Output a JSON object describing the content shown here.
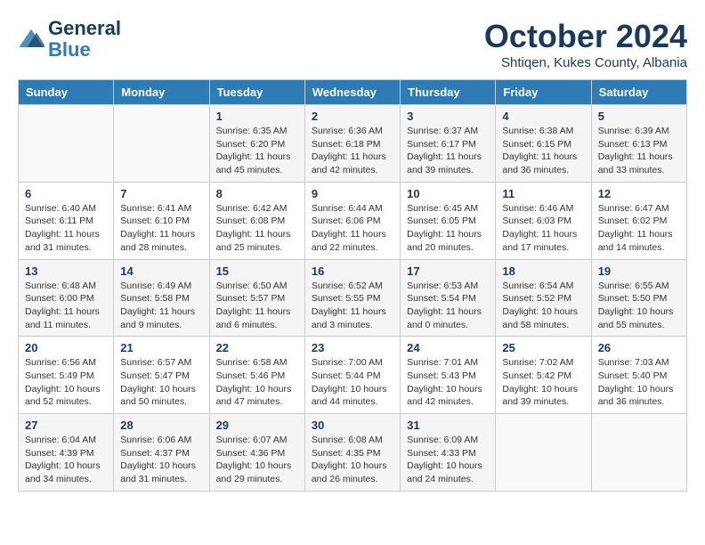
{
  "header": {
    "logo_line1": "General",
    "logo_line2": "Blue",
    "month_title": "October 2024",
    "location": "Shtiqen, Kukes County, Albania"
  },
  "days_of_week": [
    "Sunday",
    "Monday",
    "Tuesday",
    "Wednesday",
    "Thursday",
    "Friday",
    "Saturday"
  ],
  "weeks": [
    [
      {
        "day": "",
        "sunrise": "",
        "sunset": "",
        "daylight": ""
      },
      {
        "day": "",
        "sunrise": "",
        "sunset": "",
        "daylight": ""
      },
      {
        "day": "1",
        "sunrise": "Sunrise: 6:35 AM",
        "sunset": "Sunset: 6:20 PM",
        "daylight": "Daylight: 11 hours and 45 minutes."
      },
      {
        "day": "2",
        "sunrise": "Sunrise: 6:36 AM",
        "sunset": "Sunset: 6:18 PM",
        "daylight": "Daylight: 11 hours and 42 minutes."
      },
      {
        "day": "3",
        "sunrise": "Sunrise: 6:37 AM",
        "sunset": "Sunset: 6:17 PM",
        "daylight": "Daylight: 11 hours and 39 minutes."
      },
      {
        "day": "4",
        "sunrise": "Sunrise: 6:38 AM",
        "sunset": "Sunset: 6:15 PM",
        "daylight": "Daylight: 11 hours and 36 minutes."
      },
      {
        "day": "5",
        "sunrise": "Sunrise: 6:39 AM",
        "sunset": "Sunset: 6:13 PM",
        "daylight": "Daylight: 11 hours and 33 minutes."
      }
    ],
    [
      {
        "day": "6",
        "sunrise": "Sunrise: 6:40 AM",
        "sunset": "Sunset: 6:11 PM",
        "daylight": "Daylight: 11 hours and 31 minutes."
      },
      {
        "day": "7",
        "sunrise": "Sunrise: 6:41 AM",
        "sunset": "Sunset: 6:10 PM",
        "daylight": "Daylight: 11 hours and 28 minutes."
      },
      {
        "day": "8",
        "sunrise": "Sunrise: 6:42 AM",
        "sunset": "Sunset: 6:08 PM",
        "daylight": "Daylight: 11 hours and 25 minutes."
      },
      {
        "day": "9",
        "sunrise": "Sunrise: 6:44 AM",
        "sunset": "Sunset: 6:06 PM",
        "daylight": "Daylight: 11 hours and 22 minutes."
      },
      {
        "day": "10",
        "sunrise": "Sunrise: 6:45 AM",
        "sunset": "Sunset: 6:05 PM",
        "daylight": "Daylight: 11 hours and 20 minutes."
      },
      {
        "day": "11",
        "sunrise": "Sunrise: 6:46 AM",
        "sunset": "Sunset: 6:03 PM",
        "daylight": "Daylight: 11 hours and 17 minutes."
      },
      {
        "day": "12",
        "sunrise": "Sunrise: 6:47 AM",
        "sunset": "Sunset: 6:02 PM",
        "daylight": "Daylight: 11 hours and 14 minutes."
      }
    ],
    [
      {
        "day": "13",
        "sunrise": "Sunrise: 6:48 AM",
        "sunset": "Sunset: 6:00 PM",
        "daylight": "Daylight: 11 hours and 11 minutes."
      },
      {
        "day": "14",
        "sunrise": "Sunrise: 6:49 AM",
        "sunset": "Sunset: 5:58 PM",
        "daylight": "Daylight: 11 hours and 9 minutes."
      },
      {
        "day": "15",
        "sunrise": "Sunrise: 6:50 AM",
        "sunset": "Sunset: 5:57 PM",
        "daylight": "Daylight: 11 hours and 6 minutes."
      },
      {
        "day": "16",
        "sunrise": "Sunrise: 6:52 AM",
        "sunset": "Sunset: 5:55 PM",
        "daylight": "Daylight: 11 hours and 3 minutes."
      },
      {
        "day": "17",
        "sunrise": "Sunrise: 6:53 AM",
        "sunset": "Sunset: 5:54 PM",
        "daylight": "Daylight: 11 hours and 0 minutes."
      },
      {
        "day": "18",
        "sunrise": "Sunrise: 6:54 AM",
        "sunset": "Sunset: 5:52 PM",
        "daylight": "Daylight: 10 hours and 58 minutes."
      },
      {
        "day": "19",
        "sunrise": "Sunrise: 6:55 AM",
        "sunset": "Sunset: 5:50 PM",
        "daylight": "Daylight: 10 hours and 55 minutes."
      }
    ],
    [
      {
        "day": "20",
        "sunrise": "Sunrise: 6:56 AM",
        "sunset": "Sunset: 5:49 PM",
        "daylight": "Daylight: 10 hours and 52 minutes."
      },
      {
        "day": "21",
        "sunrise": "Sunrise: 6:57 AM",
        "sunset": "Sunset: 5:47 PM",
        "daylight": "Daylight: 10 hours and 50 minutes."
      },
      {
        "day": "22",
        "sunrise": "Sunrise: 6:58 AM",
        "sunset": "Sunset: 5:46 PM",
        "daylight": "Daylight: 10 hours and 47 minutes."
      },
      {
        "day": "23",
        "sunrise": "Sunrise: 7:00 AM",
        "sunset": "Sunset: 5:44 PM",
        "daylight": "Daylight: 10 hours and 44 minutes."
      },
      {
        "day": "24",
        "sunrise": "Sunrise: 7:01 AM",
        "sunset": "Sunset: 5:43 PM",
        "daylight": "Daylight: 10 hours and 42 minutes."
      },
      {
        "day": "25",
        "sunrise": "Sunrise: 7:02 AM",
        "sunset": "Sunset: 5:42 PM",
        "daylight": "Daylight: 10 hours and 39 minutes."
      },
      {
        "day": "26",
        "sunrise": "Sunrise: 7:03 AM",
        "sunset": "Sunset: 5:40 PM",
        "daylight": "Daylight: 10 hours and 36 minutes."
      }
    ],
    [
      {
        "day": "27",
        "sunrise": "Sunrise: 6:04 AM",
        "sunset": "Sunset: 4:39 PM",
        "daylight": "Daylight: 10 hours and 34 minutes."
      },
      {
        "day": "28",
        "sunrise": "Sunrise: 6:06 AM",
        "sunset": "Sunset: 4:37 PM",
        "daylight": "Daylight: 10 hours and 31 minutes."
      },
      {
        "day": "29",
        "sunrise": "Sunrise: 6:07 AM",
        "sunset": "Sunset: 4:36 PM",
        "daylight": "Daylight: 10 hours and 29 minutes."
      },
      {
        "day": "30",
        "sunrise": "Sunrise: 6:08 AM",
        "sunset": "Sunset: 4:35 PM",
        "daylight": "Daylight: 10 hours and 26 minutes."
      },
      {
        "day": "31",
        "sunrise": "Sunrise: 6:09 AM",
        "sunset": "Sunset: 4:33 PM",
        "daylight": "Daylight: 10 hours and 24 minutes."
      },
      {
        "day": "",
        "sunrise": "",
        "sunset": "",
        "daylight": ""
      },
      {
        "day": "",
        "sunrise": "",
        "sunset": "",
        "daylight": ""
      }
    ]
  ]
}
